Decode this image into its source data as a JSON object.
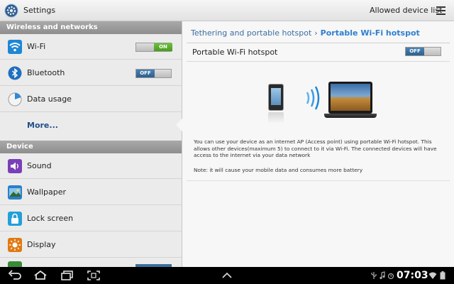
{
  "action_bar": {
    "title": "Settings",
    "action": "Allowed device list",
    "app_icon": "gear-icon",
    "overflow_icon": "menu-icon"
  },
  "sidebar": {
    "sections": [
      {
        "header": "Wireless and networks",
        "items": [
          {
            "label": "Wi-Fi",
            "icon": "wifi-icon",
            "toggle": "ON",
            "toggle_on": true
          },
          {
            "label": "Bluetooth",
            "icon": "bluetooth-icon",
            "toggle": "OFF",
            "toggle_on": false
          },
          {
            "label": "Data usage",
            "icon": "data-usage-icon"
          },
          {
            "label": "More...",
            "icon": null,
            "selected": true
          }
        ]
      },
      {
        "header": "Device",
        "items": [
          {
            "label": "Sound",
            "icon": "speaker-icon"
          },
          {
            "label": "Wallpaper",
            "icon": "image-icon"
          },
          {
            "label": "Lock screen",
            "icon": "lock-icon"
          },
          {
            "label": "Display",
            "icon": "display-icon"
          }
        ]
      }
    ]
  },
  "detail": {
    "breadcrumb": {
      "parent": "Tethering and portable hotspot",
      "separator": "›",
      "current": "Portable Wi-Fi hotspot"
    },
    "setting": {
      "title": "Portable Wi-Fi hotspot",
      "toggle": "OFF",
      "toggle_on": false
    },
    "info_text": "You can use your device as an internet AP (Access point) using portable Wi-Fi hotspot. This allows other devices(maximum 5) to connect to it via Wi-Fi. The connected devices will have access to the internet via your data network",
    "note_text": "Note: it will cause your mobile data and consumes more battery"
  },
  "system_bar": {
    "time": "07:03",
    "nav_icons": [
      "back-icon",
      "home-icon",
      "recent-apps-icon",
      "screenshot-icon"
    ],
    "status_icons": [
      "usb-icon",
      "music-icon",
      "alarm-icon",
      "wifi-signal-icon",
      "battery-icon"
    ]
  },
  "colors": {
    "accent": "#2f7fcf",
    "toggle_on": "#5aa829",
    "toggle_off": "#3b6e9e"
  }
}
